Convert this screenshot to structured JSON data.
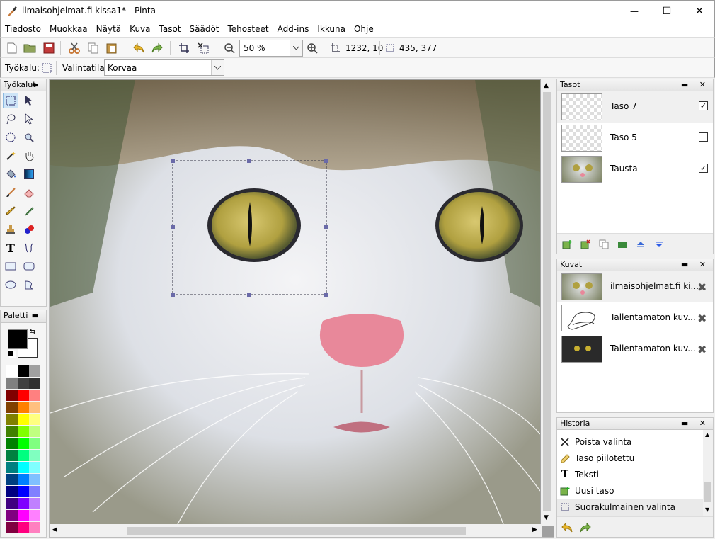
{
  "window": {
    "title": "ilmaisohjelmat.fi kissa1* - Pinta",
    "controls": {
      "minimize": "—",
      "maximize": "☐",
      "close": "✕"
    }
  },
  "menu": [
    "Tiedosto",
    "Muokkaa",
    "Näytä",
    "Kuva",
    "Tasot",
    "Säädöt",
    "Tehosteet",
    "Add-ins",
    "Ikkuna",
    "Ohje"
  ],
  "toolbar": {
    "zoom": "50 %",
    "image_size": "1232, 10",
    "cursor_position": "435, 377"
  },
  "tool_options": {
    "tool_label": "Työkalu:",
    "mode_label": "Valintatila:",
    "mode_value": "Korvaa"
  },
  "panels": {
    "tools_title": "Työkalut",
    "palette_title": "Paletti",
    "layers_title": "Tasot",
    "images_title": "Kuvat",
    "history_title": "Historia"
  },
  "layers": [
    {
      "name": "Taso 7",
      "visible": true,
      "selected": true
    },
    {
      "name": "Taso 5",
      "visible": false,
      "selected": false
    },
    {
      "name": "Tausta",
      "visible": true,
      "selected": false
    }
  ],
  "images": [
    {
      "name": "ilmaisohjelmat.fi ki..."
    },
    {
      "name": "Tallentamaton kuv..."
    },
    {
      "name": "Tallentamaton kuv..."
    }
  ],
  "history": [
    {
      "label": "Poista valinta",
      "icon": "deselect-icon"
    },
    {
      "label": "Taso piilotettu",
      "icon": "layer-hidden-icon"
    },
    {
      "label": "Teksti",
      "icon": "text-icon"
    },
    {
      "label": "Uusi taso",
      "icon": "new-layer-icon"
    },
    {
      "label": "Suorakulmainen valinta",
      "icon": "rectangle-select-icon"
    }
  ],
  "colors": {
    "primary": "#000000",
    "secondary": "#ffffff"
  }
}
